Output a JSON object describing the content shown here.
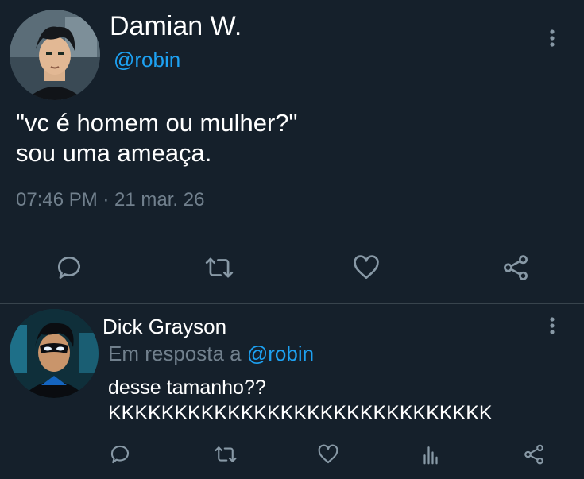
{
  "main_tweet": {
    "author_name": "Damian W.",
    "author_handle": "@robin",
    "text_line1": "\"vc é homem ou mulher?\"",
    "text_line2": "sou uma ameaça.",
    "meta": "07:46 PM · 21 mar. 26",
    "avatar_icon": "avatar-icon",
    "actions": [
      "reply-icon",
      "retweet-icon",
      "like-icon",
      "share-icon"
    ]
  },
  "reply": {
    "author_name": "Dick Grayson",
    "context_prefix": "Em resposta a",
    "context_handle": "@robin",
    "text_line1": "desse tamanho??",
    "text_line2": "KKKKKKKKKKKKKKKKKKKKKKKKKKKKK",
    "avatar_icon": "avatar-icon",
    "actions": [
      "reply-icon",
      "retweet-icon",
      "like-icon",
      "analytics-icon",
      "share-icon"
    ]
  },
  "colors": {
    "background": "#15202b",
    "accent": "#1da1f2",
    "secondary_text": "#71808d",
    "divider": "#38444d",
    "icon": "#8899a6"
  }
}
